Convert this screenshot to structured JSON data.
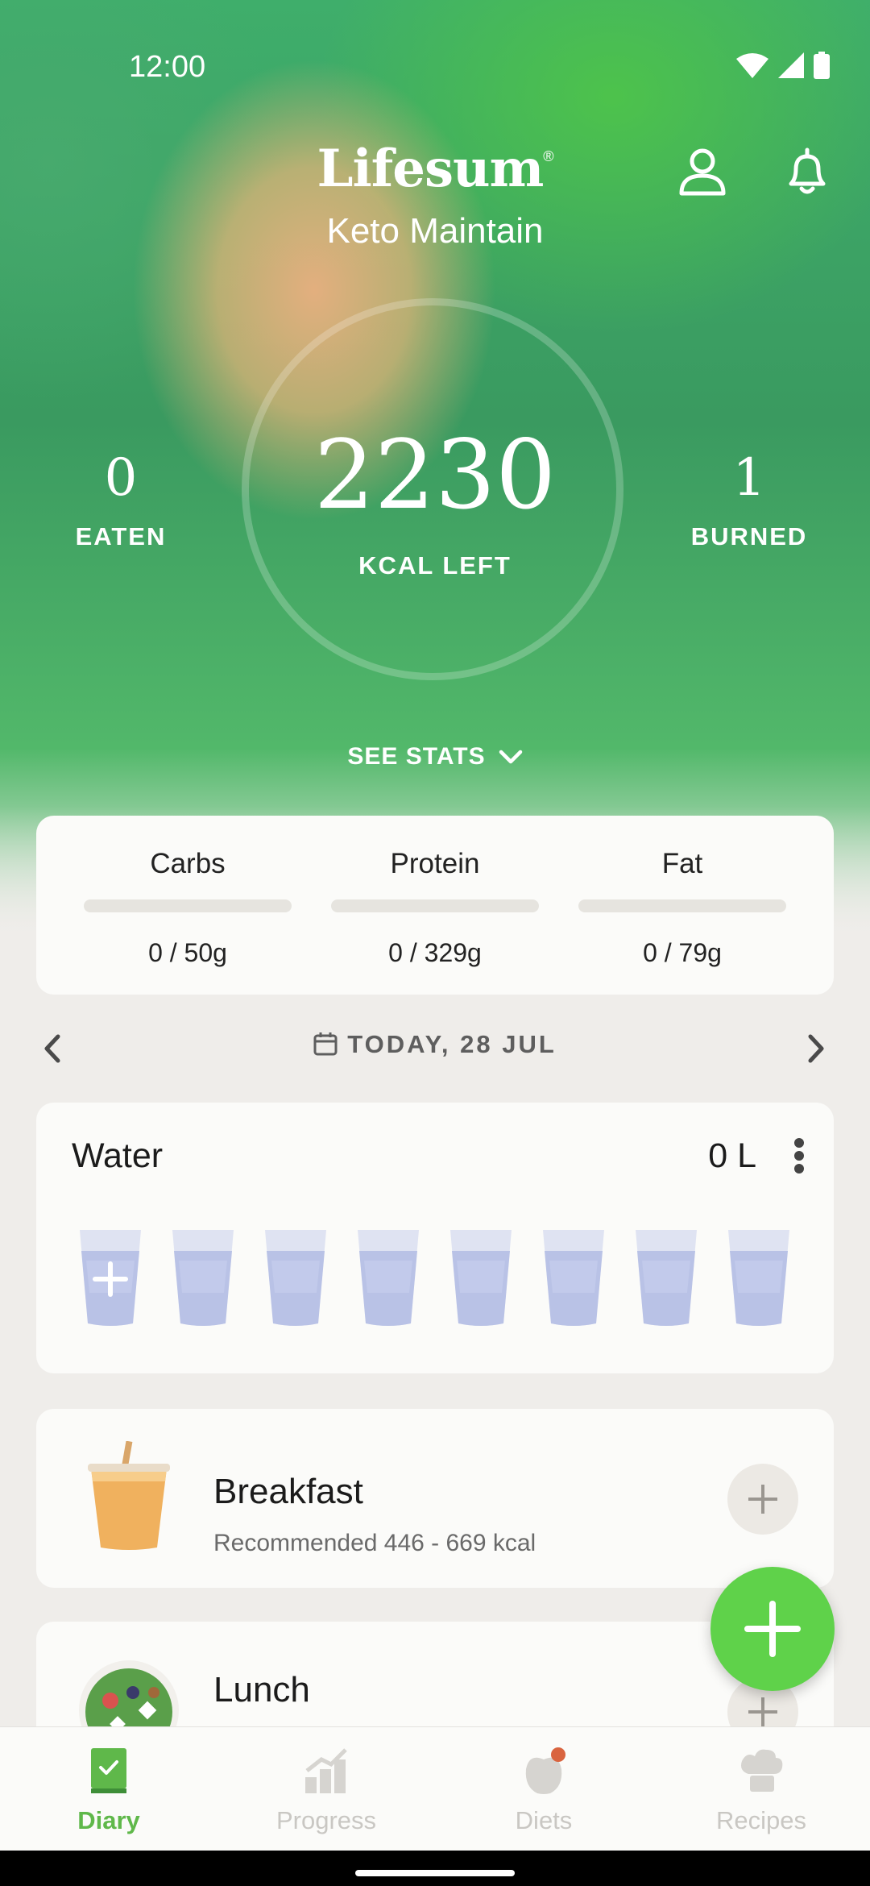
{
  "status_bar": {
    "time": "12:00"
  },
  "header": {
    "brand": "Lifesum",
    "brand_mark": "®",
    "diet_name": "Keto Maintain"
  },
  "summary": {
    "eaten_value": "0",
    "eaten_label": "EATEN",
    "kcal_left_value": "2230",
    "kcal_left_label": "KCAL LEFT",
    "burned_value": "1",
    "burned_label": "BURNED",
    "see_stats_label": "SEE STATS"
  },
  "macros": [
    {
      "name": "Carbs",
      "value": "0 / 50g",
      "progress": 0
    },
    {
      "name": "Protein",
      "value": "0 / 329g",
      "progress": 0
    },
    {
      "name": "Fat",
      "value": "0 / 79g",
      "progress": 0
    }
  ],
  "date_nav": {
    "label": "TODAY, 28 JUL"
  },
  "water": {
    "title": "Water",
    "amount": "0 L",
    "glasses_filled": 0,
    "glasses_total": 8
  },
  "meals": [
    {
      "title": "Breakfast",
      "subtitle": "Recommended 446 - 669 kcal"
    },
    {
      "title": "Lunch",
      "subtitle": ""
    }
  ],
  "tabs": [
    {
      "label": "Diary",
      "active": true
    },
    {
      "label": "Progress",
      "active": false
    },
    {
      "label": "Diets",
      "active": false
    },
    {
      "label": "Recipes",
      "active": false
    }
  ],
  "colors": {
    "accent": "#5fd24a",
    "tab_active": "#5fb84a",
    "tab_inactive": "#c9c7c3",
    "notification_dot": "#d9643f"
  }
}
